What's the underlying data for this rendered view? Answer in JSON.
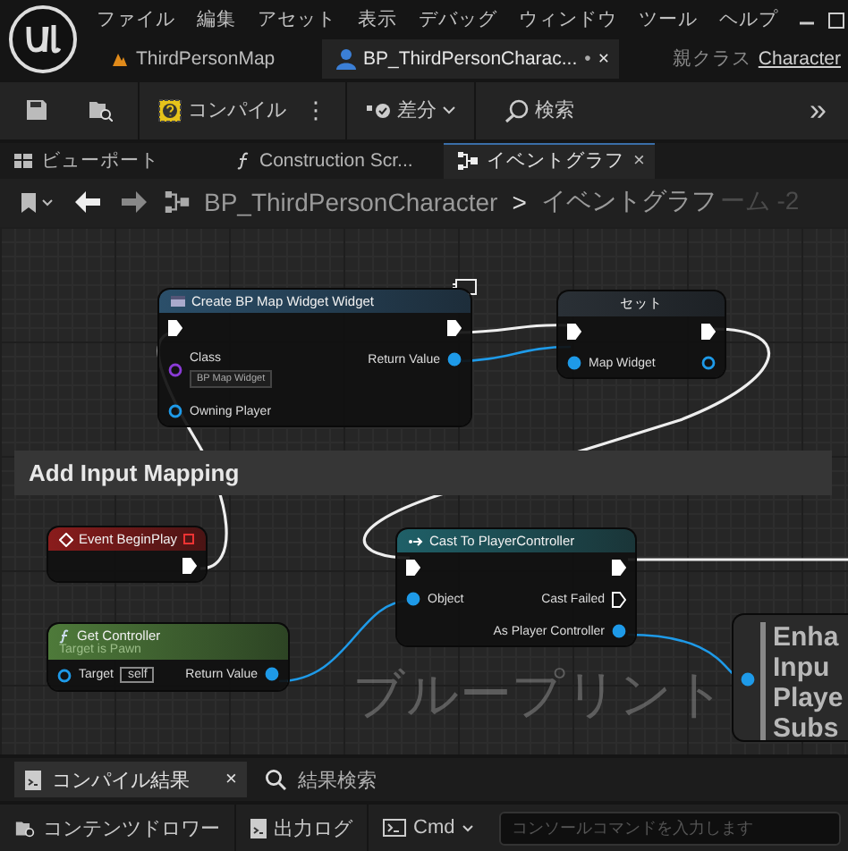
{
  "menu": [
    "ファイル",
    "編集",
    "アセット",
    "表示",
    "デバッグ",
    "ウィンドウ",
    "ツール",
    "ヘルプ"
  ],
  "doc_tabs": [
    {
      "label": "ThirdPersonMap",
      "kind": "map",
      "selected": false
    },
    {
      "label": "BP_ThirdPersonCharac...",
      "kind": "blueprint",
      "selected": true,
      "modified": "•",
      "close": "×"
    }
  ],
  "parent_class": {
    "label": "親クラス",
    "link": "Character"
  },
  "toolbar": {
    "compile": "コンパイル",
    "more": "⋮",
    "diff": "差分",
    "search": "検索",
    "overflow": "»"
  },
  "panel_tabs": [
    {
      "label": "ビューポート",
      "kind": "viewport",
      "selected": false
    },
    {
      "label": "Construction Scr...",
      "kind": "function",
      "selected": false
    },
    {
      "label": "イベントグラフ",
      "kind": "graph",
      "selected": true,
      "close": "×"
    }
  ],
  "breadcrumb": {
    "path": "BP_ThirdPersonCharacter",
    "separator": ">",
    "graph": "イベントグラフ",
    "zoom": "ーム -2"
  },
  "graph": {
    "comment": "Add Input Mapping",
    "watermark": "ブループリント",
    "nodes": [
      {
        "kind": "function",
        "title": "Create BP Map Widget Widget",
        "inputs": [
          {
            "kind": "exec",
            "connected": true
          },
          {
            "kind": "object",
            "label": "Class",
            "value": "BP Map Widget",
            "connected": false
          },
          {
            "kind": "data",
            "label": "Owning Player",
            "connected": false
          }
        ],
        "outputs": [
          {
            "kind": "exec",
            "connected": true
          },
          {
            "kind": "data",
            "label": "Return Value",
            "connected": true
          }
        ]
      },
      {
        "kind": "set",
        "title": "セット",
        "inputs": [
          {
            "kind": "exec",
            "connected": true
          },
          {
            "kind": "data",
            "label": "Map Widget",
            "connected": true
          }
        ],
        "outputs": [
          {
            "kind": "exec",
            "connected": true
          },
          {
            "kind": "data",
            "connected": false
          }
        ]
      },
      {
        "kind": "event",
        "title": "Event BeginPlay",
        "outputs": [
          {
            "kind": "exec",
            "connected": true
          }
        ]
      },
      {
        "kind": "cast",
        "title": "Cast To PlayerController",
        "inputs": [
          {
            "kind": "exec",
            "connected": true
          },
          {
            "kind": "data",
            "label": "Object",
            "connected": true
          }
        ],
        "outputs": [
          {
            "kind": "exec",
            "connected": true
          },
          {
            "kind": "exec",
            "label": "Cast Failed",
            "connected": false
          },
          {
            "kind": "data",
            "label": "As Player Controller",
            "connected": true
          }
        ]
      },
      {
        "kind": "pure",
        "title": "Get Controller",
        "subtitle": "Target is Pawn",
        "inputs": [
          {
            "kind": "data",
            "label": "Target",
            "value": "self",
            "connected": false
          }
        ],
        "outputs": [
          {
            "kind": "data",
            "label": "Return Value",
            "connected": true
          }
        ]
      },
      {
        "kind": "large",
        "title_lines": [
          "Enha",
          "Inpu",
          "Playe",
          "Subs"
        ],
        "inputs": [
          {
            "kind": "data",
            "connected": true
          }
        ]
      }
    ]
  },
  "bottom_tabs": [
    {
      "label": "コンパイル結果",
      "kind": "log",
      "selected": true,
      "close": "×"
    },
    {
      "label": "結果検索",
      "kind": "search",
      "selected": false
    }
  ],
  "status_bar": {
    "drawer": "コンテンツドロワー",
    "output_log": "出力ログ",
    "cmd": "Cmd",
    "console": {
      "placeholder": "コンソールコマンドを入力します"
    }
  }
}
